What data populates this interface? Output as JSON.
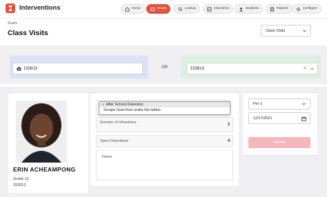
{
  "app": {
    "title": "Interventions"
  },
  "nav": {
    "items": [
      {
        "label": "Home",
        "icon": "home-icon"
      },
      {
        "label": "Scans",
        "icon": "scan-icon",
        "active": true
      },
      {
        "label": "Lookup",
        "icon": "search-icon"
      },
      {
        "label": "Outcomes",
        "icon": "outcomes-icon"
      },
      {
        "label": "Students",
        "icon": "students-icon"
      },
      {
        "label": "Reports",
        "icon": "reports-icon"
      },
      {
        "label": "Configure",
        "icon": "gear-icon"
      }
    ]
  },
  "header": {
    "breadcrumb": "Scans",
    "title": "Class Visits",
    "mode_select": "Class Visits"
  },
  "scan": {
    "student_id_input": "153913",
    "or_label": "OR",
    "student_select_value": "153913",
    "clear_symbol": "×"
  },
  "student": {
    "name": "ERIN ACHEAMPONG",
    "grade": "Grade 12",
    "id": "153913"
  },
  "intervention": {
    "options": [
      {
        "label": "After School Detention",
        "selected": true,
        "check": "✓"
      },
      {
        "label": "Scrape Gum from under the tables",
        "selected": false
      }
    ],
    "infractions_label": "Number of Infractions",
    "infractions_value": "1",
    "open_detentions_label": "Open Detentions",
    "open_detentions_value": "4",
    "notes_placeholder": "Notes"
  },
  "visit": {
    "period": "Per 1",
    "date": "12/17/2021",
    "submit_label": "Submit"
  },
  "colors": {
    "accent": "#e0533d",
    "scan_panel": "#dbe2f5",
    "select_panel": "#dcf0e2",
    "submit_disabled": "#f4b7bc",
    "background": "#f0f0f2"
  }
}
